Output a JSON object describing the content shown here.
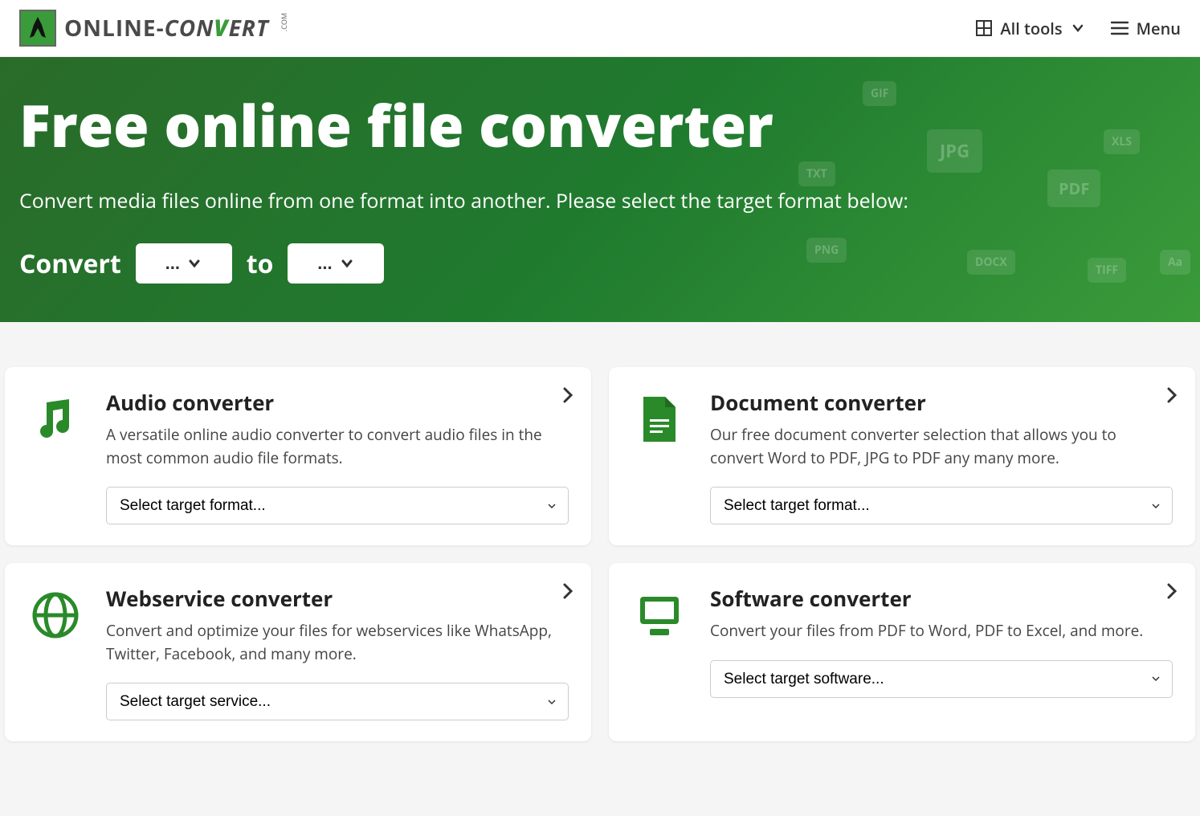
{
  "header": {
    "logo_text_1": "ONLINE-",
    "logo_text_2": "CON",
    "logo_text_3": "V",
    "logo_text_4": "ERT",
    "logo_com": ".COM",
    "all_tools": "All tools",
    "menu": "Menu"
  },
  "hero": {
    "title": "Free online file converter",
    "subtitle": "Convert media files online from one format into another. Please select the target format below:",
    "convert_label": "Convert",
    "to_label": "to",
    "from_value": "...",
    "to_value": "..."
  },
  "cards": [
    {
      "title": "Audio converter",
      "desc": "A versatile online audio converter to convert audio files in the most common audio file formats.",
      "select_placeholder": "Select target format..."
    },
    {
      "title": "Document converter",
      "desc": "Our free document converter selection that allows you to convert Word to PDF, JPG to PDF any many more.",
      "select_placeholder": "Select target format..."
    },
    {
      "title": "Webservice converter",
      "desc": "Convert and optimize your files for webservices like WhatsApp, Twitter, Facebook, and many more.",
      "select_placeholder": "Select target service..."
    },
    {
      "title": "Software converter",
      "desc": "Convert your files from PDF to Word, PDF to Excel, and more.",
      "select_placeholder": "Select target software..."
    }
  ]
}
